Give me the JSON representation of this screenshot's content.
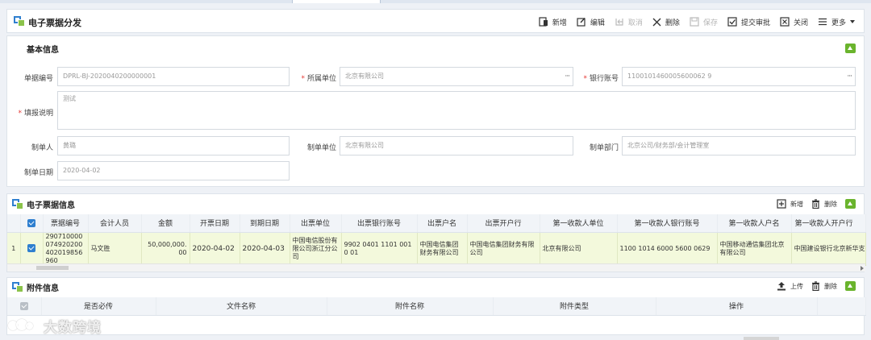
{
  "page": {
    "title": "电子票据分发"
  },
  "toolbar": [
    {
      "label": "新增",
      "icon": "new-doc-icon",
      "disabled": false
    },
    {
      "label": "编辑",
      "icon": "edit-icon",
      "disabled": false
    },
    {
      "label": "取消",
      "icon": "cancel-icon",
      "disabled": true
    },
    {
      "label": "删除",
      "icon": "delete-x-icon",
      "disabled": false
    },
    {
      "label": "保存",
      "icon": "save-icon",
      "disabled": true
    },
    {
      "label": "提交审批",
      "icon": "submit-check-icon",
      "disabled": false
    },
    {
      "label": "关闭",
      "icon": "close-box-icon",
      "disabled": false
    },
    {
      "label": "更多",
      "icon": "menu-icon",
      "disabled": false
    }
  ],
  "basic": {
    "title": "基本信息",
    "doc_no_label": "单据编号",
    "doc_no_value": "DPRL-BJ-2020040200000001",
    "unit_label": "所属单位",
    "unit_value": "北京有限公司",
    "bank_label": "银行账号",
    "bank_value": "1100101460005600062 9",
    "remark_label": "填报说明",
    "remark_value": "测试",
    "maker_label": "制单人",
    "maker_value": "黄璐",
    "maker_unit_label": "制单单位",
    "maker_unit_value": "北京有限公司",
    "maker_dept_label": "制单部门",
    "maker_dept_value": "北京公司/财务部/会计管理室",
    "date_label": "制单日期",
    "date_value": "2020-04-02"
  },
  "grid": {
    "title": "电子票据信息",
    "add_label": "新增",
    "delete_label": "删除",
    "columns": [
      "票据编号",
      "会计人员",
      "金额",
      "开票日期",
      "到期日期",
      "出票单位",
      "出票银行账号",
      "出票户名",
      "出票开户行",
      "第一收款人单位",
      "第一收款人银行账号",
      "第一收款人户名",
      "第一收款人开户行"
    ],
    "rows": [
      {
        "index": "1",
        "cells": [
          "290710000074920200402019856960",
          "马文胜",
          "50,000,000.00",
          "2020-04-02",
          "2020-04-03",
          "中国电信股份有限公司浙江分公司",
          "9902 0401 1101 0010 01",
          "中国电信集团财务有限公司",
          "中国电信集团财务有限公司",
          "北京有限公司",
          "1100 1014 6000 5600 0629",
          "中国移动通信集团北京有限公司",
          "中国建设银行北京新华支行"
        ]
      }
    ]
  },
  "attachments": {
    "title": "附件信息",
    "upload_label": "上传",
    "delete_label": "删除",
    "columns": [
      "是否必传",
      "文件名称",
      "附件名称",
      "附件类型",
      "操作"
    ]
  },
  "watermark": {
    "text": "大数跨境"
  },
  "colors": {
    "accent_blue": "#2f7fcf",
    "accent_green": "#6ab42d",
    "selected_row": "#f3f9dc"
  }
}
